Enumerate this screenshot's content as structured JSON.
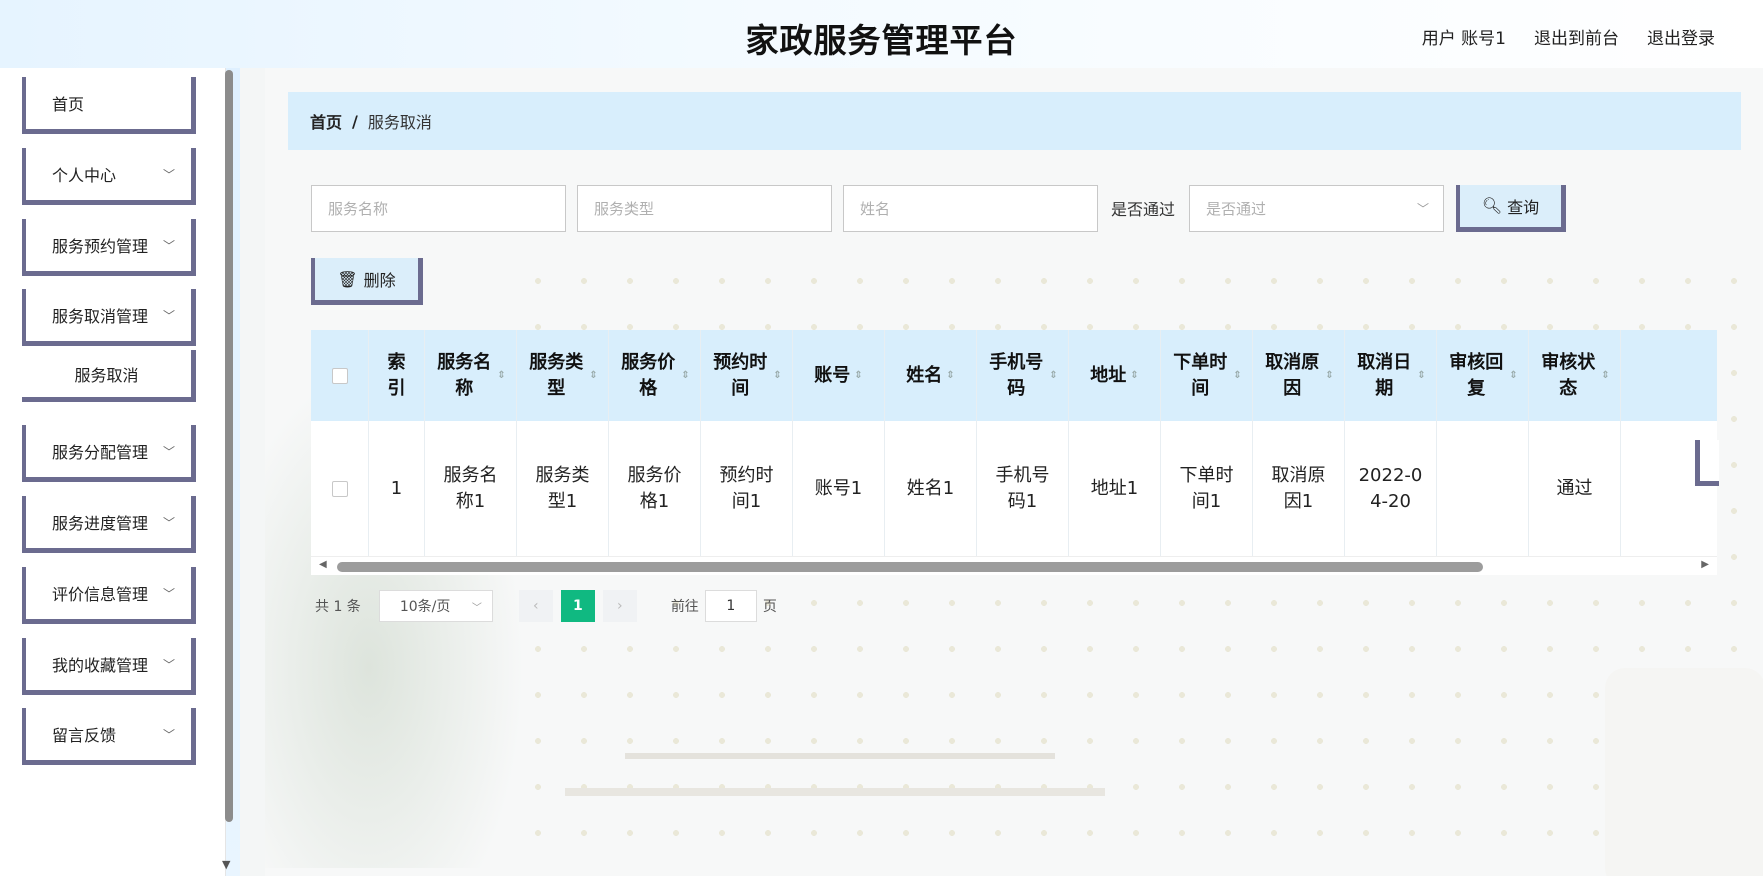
{
  "app": {
    "title": "家政服务管理平台",
    "user_label": "用户 账号1",
    "back_to_front": "退出到前台",
    "logout": "退出登录"
  },
  "sidebar": {
    "items": [
      {
        "label": "首页",
        "has_arrow": false
      },
      {
        "label": "个人中心",
        "has_arrow": true
      },
      {
        "label": "服务预约管理",
        "has_arrow": true
      },
      {
        "label": "服务取消管理",
        "has_arrow": true
      },
      {
        "label": "服务取消",
        "has_arrow": false,
        "submenu": true
      },
      {
        "label": "服务分配管理",
        "has_arrow": true
      },
      {
        "label": "服务进度管理",
        "has_arrow": true
      },
      {
        "label": "评价信息管理",
        "has_arrow": true
      },
      {
        "label": "我的收藏管理",
        "has_arrow": true
      },
      {
        "label": "留言反馈",
        "has_arrow": true
      }
    ]
  },
  "breadcrumb": {
    "home": "首页",
    "separator": "/",
    "current": "服务取消"
  },
  "search": {
    "service_name_placeholder": "服务名称",
    "service_type_placeholder": "服务类型",
    "name_placeholder": "姓名",
    "pass_label": "是否通过",
    "pass_select_placeholder": "是否通过",
    "query_button": "查询"
  },
  "actions": {
    "delete_button": "删除"
  },
  "table": {
    "headers": [
      "索引",
      "服务名称",
      "服务类型",
      "服务价格",
      "预约时间",
      "账号",
      "姓名",
      "手机号码",
      "地址",
      "下单时间",
      "取消原因",
      "取消日期",
      "审核回复",
      "审核状态"
    ],
    "rows": [
      [
        "1",
        "服务名称1",
        "服务类型1",
        "服务价格1",
        "预约时间1",
        "账号1",
        "姓名1",
        "手机号码1",
        "地址1",
        "下单时间1",
        "取消原因1",
        "2022-04-20",
        "",
        "通过"
      ]
    ]
  },
  "pagination": {
    "total": "共 1 条",
    "page_size": "10条/页",
    "current_page": "1",
    "goto_label": "前往",
    "goto_value": "1",
    "page_suffix": "页"
  },
  "colors": {
    "accent": "#10b981",
    "frame": "#6b6b8f",
    "header_bg": "#d8eefc"
  }
}
